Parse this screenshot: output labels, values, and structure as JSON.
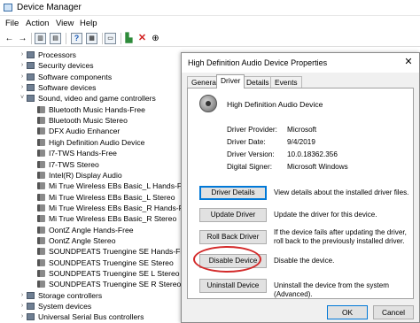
{
  "window": {
    "title": "Device Manager"
  },
  "menu": [
    "File",
    "Action",
    "View",
    "Help"
  ],
  "tree": [
    {
      "label": "Processors",
      "icon": "processor-icon",
      "expander": "›"
    },
    {
      "label": "Security devices",
      "icon": "security-device-icon",
      "expander": "›"
    },
    {
      "label": "Software components",
      "icon": "software-component-icon",
      "expander": "›"
    },
    {
      "label": "Software devices",
      "icon": "software-device-icon",
      "expander": "›"
    },
    {
      "label": "Sound, video and game controllers",
      "icon": "sound-icon",
      "expander": "˅"
    },
    {
      "label": "Bluetooth Music Hands-Free",
      "icon": "speaker-icon",
      "expander": ""
    },
    {
      "label": "Bluetooth Music Stereo",
      "icon": "speaker-icon",
      "expander": ""
    },
    {
      "label": "DFX Audio Enhancer",
      "icon": "speaker-icon",
      "expander": ""
    },
    {
      "label": "High Definition Audio Device",
      "icon": "speaker-icon",
      "expander": ""
    },
    {
      "label": "I7-TWS Hands-Free",
      "icon": "speaker-icon",
      "expander": ""
    },
    {
      "label": "I7-TWS Stereo",
      "icon": "speaker-icon",
      "expander": ""
    },
    {
      "label": "Intel(R) Display Audio",
      "icon": "speaker-icon",
      "expander": ""
    },
    {
      "label": "Mi True Wireless EBs Basic_L Hands-Free",
      "icon": "speaker-icon",
      "expander": ""
    },
    {
      "label": "Mi True Wireless EBs Basic_L Stereo",
      "icon": "speaker-icon",
      "expander": ""
    },
    {
      "label": "Mi True Wireless EBs Basic_R Hands-Free",
      "icon": "speaker-icon",
      "expander": ""
    },
    {
      "label": "Mi True Wireless EBs Basic_R Stereo",
      "icon": "speaker-icon",
      "expander": ""
    },
    {
      "label": "OontZ Angle Hands-Free",
      "icon": "speaker-icon",
      "expander": ""
    },
    {
      "label": "OontZ Angle Stereo",
      "icon": "speaker-icon",
      "expander": ""
    },
    {
      "label": "SOUNDPEATS Truengine SE Hands-Free",
      "icon": "speaker-icon",
      "expander": ""
    },
    {
      "label": "SOUNDPEATS Truengine SE Stereo",
      "icon": "speaker-icon",
      "expander": ""
    },
    {
      "label": "SOUNDPEATS Truengine SE L Stereo",
      "icon": "speaker-icon",
      "expander": ""
    },
    {
      "label": "SOUNDPEATS Truengine SE R Stereo",
      "icon": "speaker-icon",
      "expander": ""
    },
    {
      "label": "Storage controllers",
      "icon": "storage-icon",
      "expander": "›"
    },
    {
      "label": "System devices",
      "icon": "system-device-icon",
      "expander": "›"
    },
    {
      "label": "Universal Serial Bus controllers",
      "icon": "usb-icon",
      "expander": "›"
    }
  ],
  "dialog": {
    "title": "High Definition Audio Device Properties",
    "tabs": [
      "General",
      "Driver",
      "Details",
      "Events"
    ],
    "active_tab": "Driver",
    "device_name": "High Definition Audio Device",
    "properties": [
      {
        "label": "Driver Provider:",
        "value": "Microsoft"
      },
      {
        "label": "Driver Date:",
        "value": "9/4/2019"
      },
      {
        "label": "Driver Version:",
        "value": "10.0.18362.356"
      },
      {
        "label": "Digital Signer:",
        "value": "Microsoft Windows"
      }
    ],
    "actions": [
      {
        "button": "Driver Details",
        "description": "View details about the installed driver files."
      },
      {
        "button": "Update Driver",
        "description": "Update the driver for this device."
      },
      {
        "button": "Roll Back Driver",
        "description": "If the device fails after updating the driver, roll back to the previously installed driver."
      },
      {
        "button": "Disable Device",
        "description": "Disable the device."
      },
      {
        "button": "Uninstall Device",
        "description": "Uninstall the device from the system (Advanced)."
      }
    ],
    "ok_label": "OK",
    "cancel_label": "Cancel",
    "close_glyph": "✕"
  },
  "colors": {
    "highlight_circle": "#d32a2a",
    "focus_blue": "#0078d7"
  }
}
